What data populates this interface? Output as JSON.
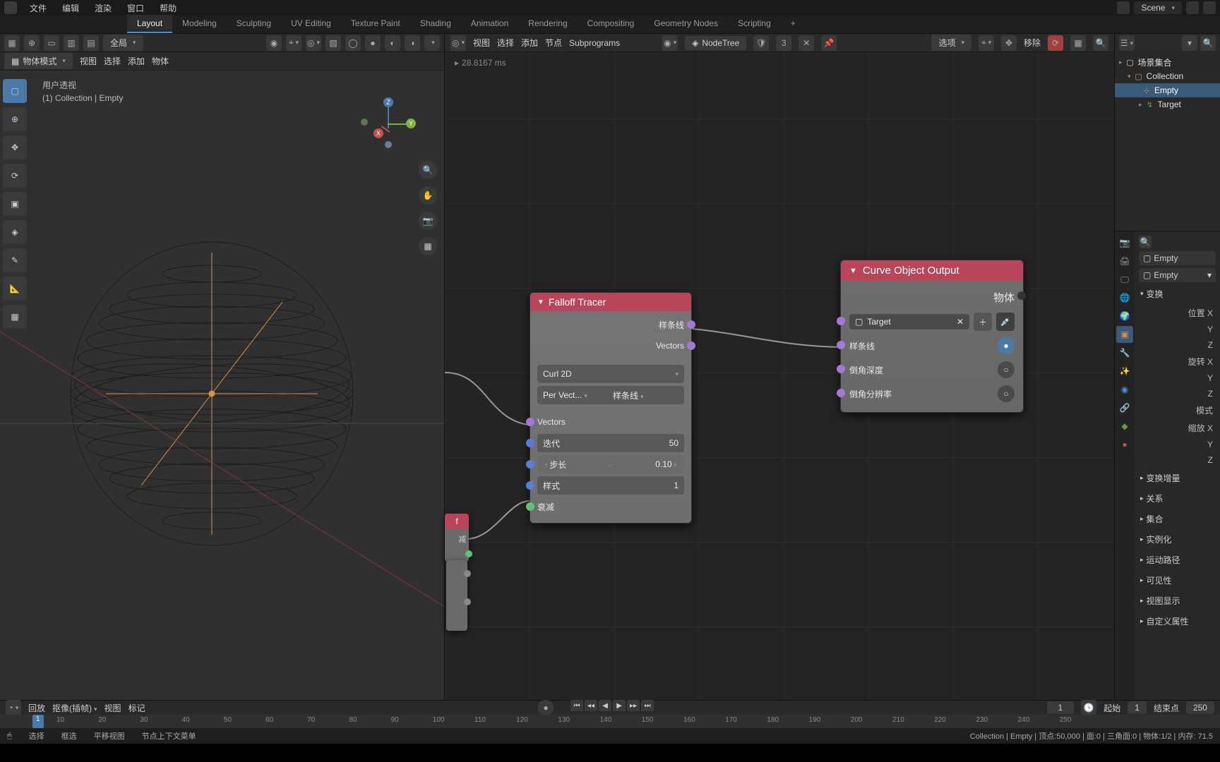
{
  "topbar": {
    "menus": [
      "文件",
      "编辑",
      "渲染",
      "窗口",
      "帮助"
    ],
    "scene_prefix": "Scene"
  },
  "workspaces": {
    "tabs": [
      "Layout",
      "Modeling",
      "Sculpting",
      "UV Editing",
      "Texture Paint",
      "Shading",
      "Animation",
      "Rendering",
      "Compositing",
      "Geometry Nodes",
      "Scripting"
    ],
    "active_index": 0
  },
  "viewport": {
    "toolbar": {
      "global": "全局"
    },
    "toolbar2": {
      "mode": "物体模式",
      "buttons": [
        "视图",
        "选择",
        "添加",
        "物体"
      ]
    },
    "overlay": {
      "line1": "用户透视",
      "line2": "(1) Collection | Empty"
    },
    "gizmo": {
      "z": "Z",
      "y": "Y",
      "x": "X"
    }
  },
  "node_editor": {
    "toolbar": {
      "buttons": [
        "视图",
        "选择",
        "添加",
        "节点",
        "Subprograms"
      ],
      "tree": "NodeTree",
      "translate": "移除",
      "snap_label": "选项"
    },
    "perf": "28.8167 ms",
    "falloff": {
      "title": "Falloff Tracer",
      "out1": "样条线",
      "out2": "Vectors",
      "drop1": "Curl 2D",
      "drop2a": "Per Vect...",
      "drop2b": "样条线",
      "in_vectors": "Vectors",
      "iter_lbl": "迭代",
      "iter_val": "50",
      "step_lbl": "步长",
      "step_val": "0.10",
      "mode_lbl": "样式",
      "mode_val": "1",
      "decay": "衰减"
    },
    "curve_out": {
      "title": "Curve Object Output",
      "obj_lbl": "物体",
      "target": "Target",
      "in1": "样条线",
      "in2": "倒角深度",
      "in3": "倒角分辨率"
    },
    "mini": {
      "hdr": "f",
      "lbl": "减"
    }
  },
  "outliner": {
    "items": [
      {
        "name": "场景集合",
        "depth": 0,
        "icon": "▢",
        "sel": false
      },
      {
        "name": "Collection",
        "depth": 1,
        "icon": "▢",
        "sel": false
      },
      {
        "name": "Empty",
        "depth": 2,
        "icon": "⊹",
        "sel": true
      },
      {
        "name": "Target",
        "depth": 2,
        "icon": "↯",
        "sel": false
      }
    ]
  },
  "properties": {
    "crumb1": "Empty",
    "crumb2": "Empty",
    "section_transform": "变换",
    "loc_x": "位置 X",
    "axis_y": "Y",
    "axis_z": "Z",
    "rot_x": "旋转 X",
    "mode": "模式",
    "scale_x": "缩放 X",
    "delta": "变换增量",
    "others": [
      "关系",
      "集合",
      "实例化",
      "运动路径",
      "可见性",
      "视图显示",
      "自定义属性"
    ]
  },
  "timeline": {
    "left": [
      "回放",
      "抠像(插帧)",
      "视图",
      "标记"
    ],
    "current": "1",
    "start_lbl": "起始",
    "start": "1",
    "end_lbl": "结束点",
    "end": "250",
    "ticks": [
      "10",
      "20",
      "30",
      "40",
      "50",
      "60",
      "70",
      "80",
      "90",
      "100",
      "110",
      "120",
      "130",
      "140",
      "150",
      "160",
      "170",
      "180",
      "190",
      "200",
      "210",
      "220",
      "230",
      "240",
      "250"
    ],
    "cur_frame": "1"
  },
  "status": {
    "items": [
      "选择",
      "框选",
      "平移视图",
      "节点上下文菜单"
    ],
    "right": "Collection | Empty   |   顶点:50,000  |  面:0  |  三角面:0  |  物体:1/2  | 内存: 71.5"
  }
}
